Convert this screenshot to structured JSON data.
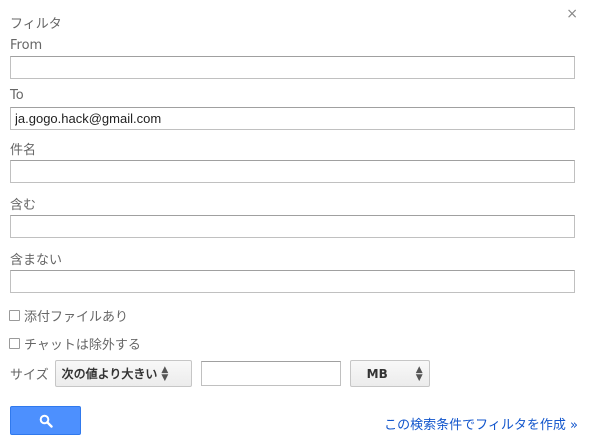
{
  "dialog": {
    "title": "フィルタ",
    "close_glyph": "×"
  },
  "fields": {
    "from": {
      "label": "From",
      "value": ""
    },
    "to": {
      "label": "To",
      "value": "ja.gogo.hack@gmail.com"
    },
    "subject": {
      "label": "件名",
      "value": ""
    },
    "has_words": {
      "label": "含む",
      "value": ""
    },
    "doesnt_have": {
      "label": "含まない",
      "value": ""
    }
  },
  "options": {
    "has_attachment": {
      "label": "添付ファイルあり",
      "checked": false
    },
    "exclude_chats": {
      "label": "チャットは除外する",
      "checked": false
    }
  },
  "size": {
    "label": "サイズ",
    "comparator": "次の値より大きい",
    "value": "",
    "unit": "MB"
  },
  "actions": {
    "search_icon": "search-icon",
    "create_filter_link": "この検索条件でフィルタを作成 »"
  },
  "colors": {
    "accent": "#4d90fe",
    "link": "#1155cc"
  }
}
